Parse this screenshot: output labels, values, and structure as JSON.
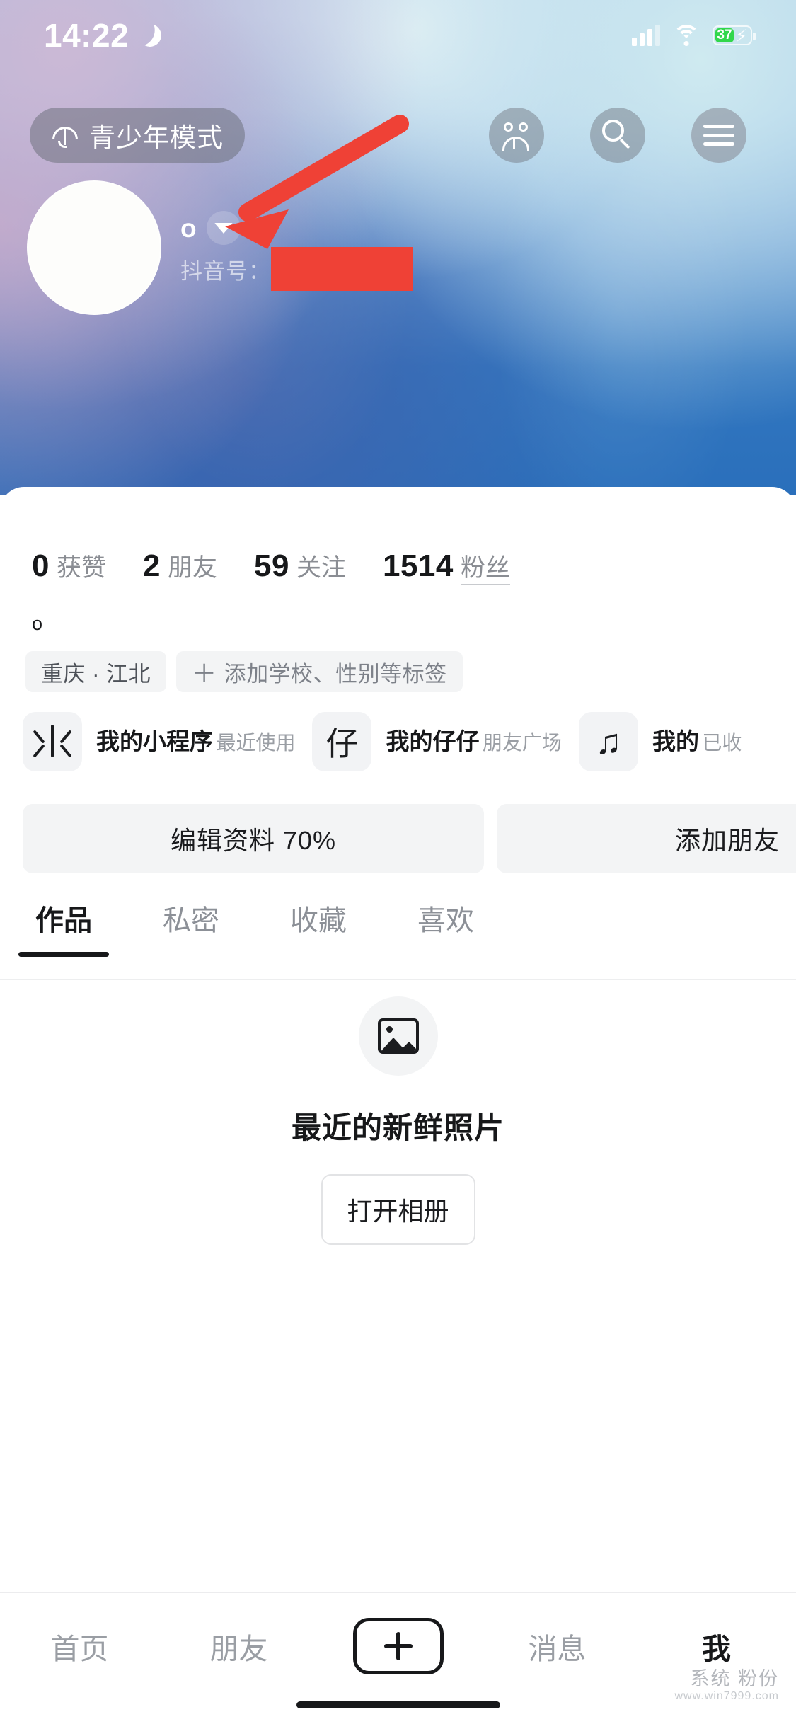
{
  "status_bar": {
    "time": "14:22",
    "moon_icon": "moon-icon",
    "signal_icon": "cellular-signal-icon",
    "wifi_icon": "wifi-icon",
    "battery_percent": "37",
    "battery_charging_icon": "lightning-bolt-icon"
  },
  "top_bar": {
    "teen_mode_label": "青少年模式",
    "teen_mode_icon": "umbrella-icon",
    "friends_icon": "people-icon",
    "search_icon": "search-icon",
    "menu_icon": "hamburger-menu-icon"
  },
  "profile": {
    "avatar_icon": "avatar-placeholder",
    "username": "o",
    "dropdown_icon": "chevron-down-icon",
    "douyin_id_label": "抖音号：",
    "douyin_id_value": "",
    "redaction_color": "#ef4136"
  },
  "stats": [
    {
      "num": "0",
      "label": "获赞"
    },
    {
      "num": "2",
      "label": "朋友"
    },
    {
      "num": "59",
      "label": "关注"
    },
    {
      "num": "1514",
      "label": "粉丝"
    }
  ],
  "bio": "o",
  "tags": [
    {
      "text": "重庆 · 江北",
      "has_plus": false
    },
    {
      "text": "添加学校、性别等标签",
      "has_plus": true,
      "plus": "＋"
    }
  ],
  "cards": [
    {
      "icon": "mini-program-icon",
      "glyph": "",
      "title": "我的小程序",
      "subtitle": "最近使用"
    },
    {
      "icon": "zaizai-icon",
      "glyph": "仔",
      "title": "我的仔仔",
      "subtitle": "朋友广场"
    },
    {
      "icon": "music-note-icon",
      "glyph": "♫",
      "title": "我的",
      "subtitle": "已收"
    }
  ],
  "actions": {
    "edit_profile": "编辑资料 70%",
    "add_friend": "添加朋友"
  },
  "tabs": [
    {
      "label": "作品",
      "active": true
    },
    {
      "label": "私密",
      "active": false
    },
    {
      "label": "收藏",
      "active": false
    },
    {
      "label": "喜欢",
      "active": false
    }
  ],
  "empty_state": {
    "image_icon": "photo-placeholder-icon",
    "title": "最近的新鲜照片",
    "button": "打开相册"
  },
  "bottom_nav": {
    "items": [
      {
        "label": "首页",
        "active": false
      },
      {
        "label": "朋友",
        "active": false
      },
      {
        "label": "",
        "active": false,
        "icon": "plus-create-icon"
      },
      {
        "label": "消息",
        "active": false
      },
      {
        "label": "我",
        "active": true
      }
    ]
  },
  "watermark": {
    "line1": "系统 粉份",
    "line2": "www.win7999.com"
  },
  "annotation": {
    "arrow_icon": "red-arrow-annotation",
    "arrow_color": "#ef4136"
  }
}
